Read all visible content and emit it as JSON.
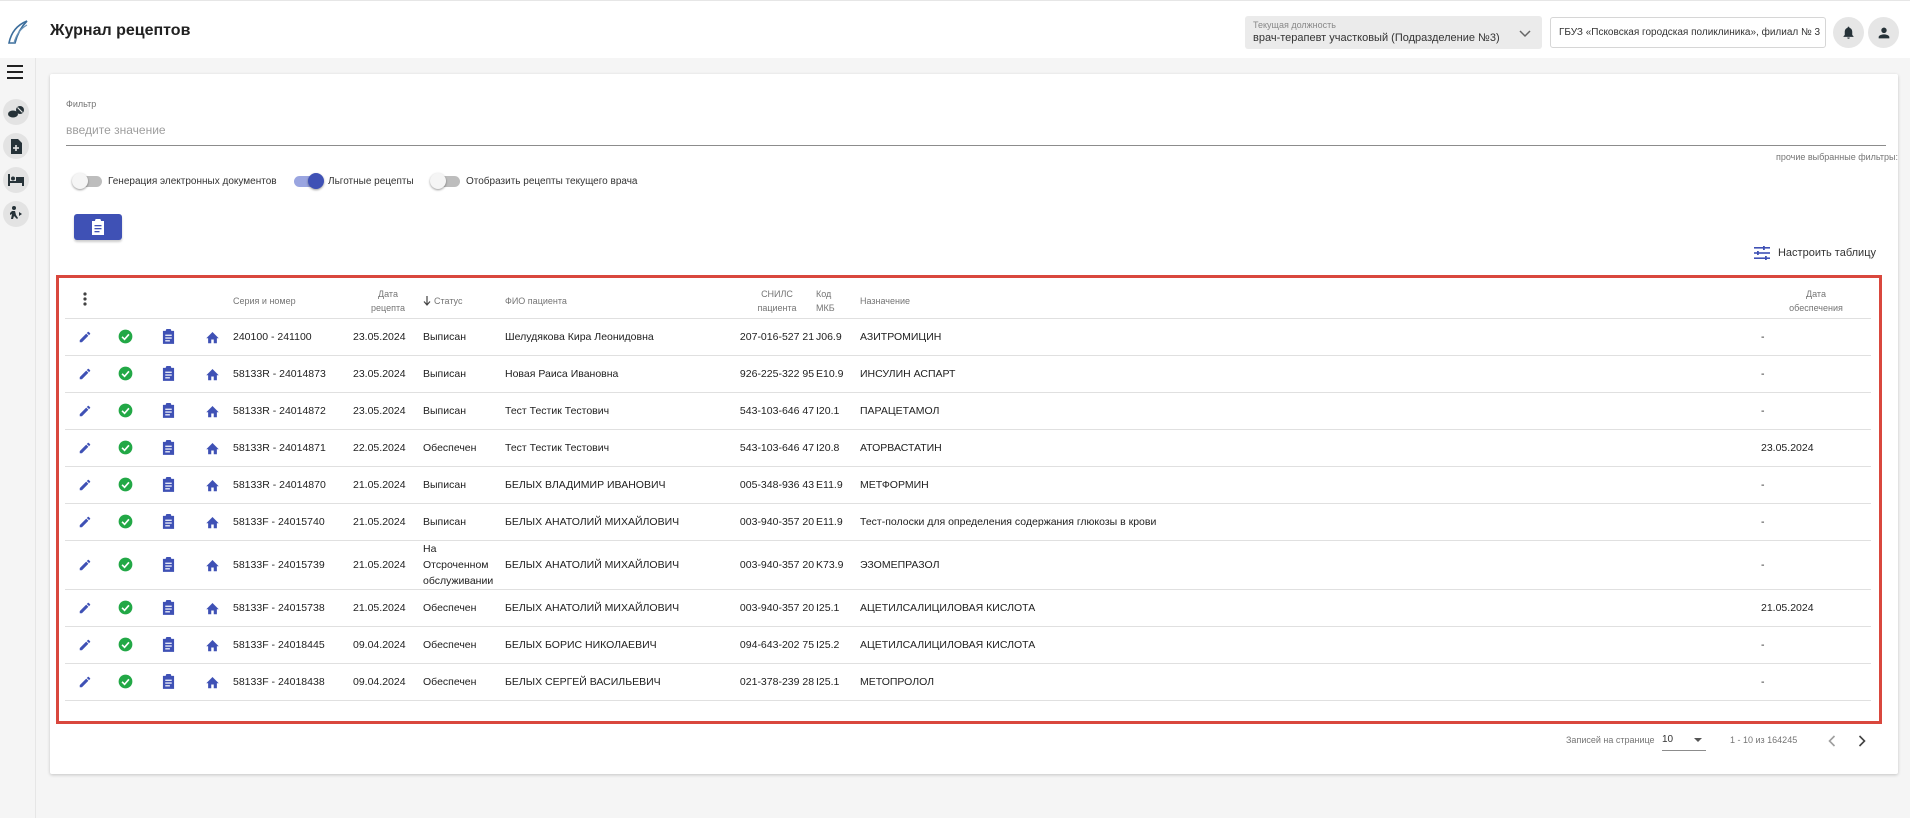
{
  "header": {
    "title": "Журнал рецептов",
    "position_label": "Текущая должность",
    "position_value": "врач-терапевт участковый (Подразделение №3)",
    "organization": "ГБУЗ «Псковская городская поликлиника», филиал № 3"
  },
  "filter": {
    "label": "Фильтр",
    "placeholder": "введите значение",
    "other_filters": "прочие выбранные фильтры:"
  },
  "toggles": [
    {
      "label": "Генерация электронных документов",
      "on": false
    },
    {
      "label": "Льготные рецепты",
      "on": true
    },
    {
      "label": "Отобразить рецепты текущего врача",
      "on": false
    }
  ],
  "configure_label": "Настроить таблицу",
  "table": {
    "columns": {
      "series": "Серия и номер",
      "date": "Дата рецепта",
      "status": "Статус",
      "patient": "ФИО пациента",
      "snils": "СНИЛС пациента",
      "mkb": "Код МКБ",
      "assignment": "Назначение",
      "supply_date": "Дата обеспечения"
    },
    "rows": [
      {
        "series": "240100 - 241100",
        "date": "23.05.2024",
        "status": "Выписан",
        "patient": "Шелудякова Кира Леонидовна",
        "snils": "207-016-527 21",
        "mkb": "J06.9",
        "assignment": "АЗИТРОМИЦИН",
        "supply_date": "-"
      },
      {
        "series": "58133R - 24014873",
        "date": "23.05.2024",
        "status": "Выписан",
        "patient": "Новая Раиса Ивановна",
        "snils": "926-225-322 95",
        "mkb": "E10.9",
        "assignment": "ИНСУЛИН АСПАРТ",
        "supply_date": "-"
      },
      {
        "series": "58133R - 24014872",
        "date": "23.05.2024",
        "status": "Выписан",
        "patient": "Тест Тестик Тестович",
        "snils": "543-103-646 47",
        "mkb": "I20.1",
        "assignment": "ПАРАЦЕТАМОЛ",
        "supply_date": "-"
      },
      {
        "series": "58133R - 24014871",
        "date": "22.05.2024",
        "status": "Обеспечен",
        "patient": "Тест Тестик Тестович",
        "snils": "543-103-646 47",
        "mkb": "I20.8",
        "assignment": "АТОРВАСТАТИН",
        "supply_date": "23.05.2024"
      },
      {
        "series": "58133R - 24014870",
        "date": "21.05.2024",
        "status": "Выписан",
        "patient": "БЕЛЫХ ВЛАДИМИР ИВАНОВИЧ",
        "snils": "005-348-936 43",
        "mkb": "E11.9",
        "assignment": "МЕТФОРМИН",
        "supply_date": "-"
      },
      {
        "series": "58133F - 24015740",
        "date": "21.05.2024",
        "status": "Выписан",
        "patient": "БЕЛЫХ АНАТОЛИЙ МИХАЙЛОВИЧ",
        "snils": "003-940-357 20",
        "mkb": "E11.9",
        "assignment": "Тест-полоски для определения содержания глюкозы в крови",
        "supply_date": "-"
      },
      {
        "series": "58133F - 24015739",
        "date": "21.05.2024",
        "status": "На Отсроченном обслуживании",
        "patient": "БЕЛЫХ АНАТОЛИЙ МИХАЙЛОВИЧ",
        "snils": "003-940-357 20",
        "mkb": "K73.9",
        "assignment": "ЭЗОМЕПРАЗОЛ",
        "supply_date": "-"
      },
      {
        "series": "58133F - 24015738",
        "date": "21.05.2024",
        "status": "Обеспечен",
        "patient": "БЕЛЫХ АНАТОЛИЙ МИХАЙЛОВИЧ",
        "snils": "003-940-357 20",
        "mkb": "I25.1",
        "assignment": "АЦЕТИЛСАЛИЦИЛОВАЯ КИСЛОТА",
        "supply_date": "21.05.2024"
      },
      {
        "series": "58133F - 24018445",
        "date": "09.04.2024",
        "status": "Обеспечен",
        "patient": "БЕЛЫХ БОРИС НИКОЛАЕВИЧ",
        "snils": "094-643-202 75",
        "mkb": "I25.2",
        "assignment": "АЦЕТИЛСАЛИЦИЛОВАЯ КИСЛОТА",
        "supply_date": "-"
      },
      {
        "series": "58133F - 24018438",
        "date": "09.04.2024",
        "status": "Обеспечен",
        "patient": "БЕЛЫХ СЕРГЕЙ ВАСИЛЬЕВИЧ",
        "snils": "021-378-239 28",
        "mkb": "I25.1",
        "assignment": "МЕТОПРОЛОЛ",
        "supply_date": "-"
      }
    ]
  },
  "pagination": {
    "per_page_label": "Записей на странице",
    "per_page_value": "10",
    "range": "1 - 10 из 164245"
  },
  "colors": {
    "primary": "#3f51b5",
    "success": "#22a846",
    "highlight_border": "#d9473d"
  },
  "icons": {
    "row_actions": [
      "pencil-icon",
      "check-circle-icon",
      "clipboard-icon",
      "home-icon"
    ],
    "sidebar": [
      "menu-icon",
      "pills-icon",
      "document-plus-icon",
      "bed-icon",
      "person-walking-icon"
    ]
  }
}
